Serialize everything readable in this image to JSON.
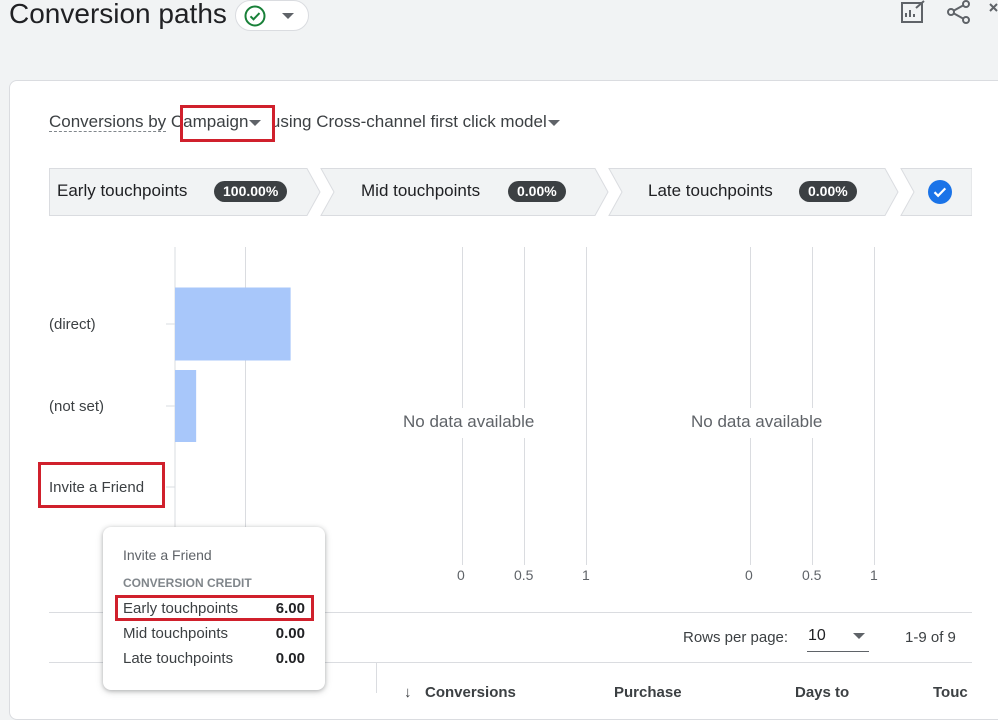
{
  "header": {
    "title": "Conversion paths"
  },
  "selector": {
    "prefix": "Conversions by",
    "dimension": "Campaign",
    "model_text": "using Cross-channel first click model"
  },
  "stages": [
    {
      "label": "Early touchpoints",
      "badge": "100.00%"
    },
    {
      "label": "Mid touchpoints",
      "badge": "0.00%"
    },
    {
      "label": "Late touchpoints",
      "badge": "0.00%"
    }
  ],
  "chart_data": [
    {
      "type": "bar",
      "orientation": "horizontal",
      "categories": [
        "(direct)",
        "(not set)",
        "Invite a Friend"
      ],
      "series": [
        {
          "name": "Early touchpoints",
          "values": [
            0.82,
            0.15,
            0
          ]
        }
      ]
    },
    {
      "type": "bar",
      "orientation": "horizontal",
      "message": "No data available",
      "xticks": [
        "0",
        "0.5",
        "1"
      ]
    },
    {
      "type": "bar",
      "orientation": "horizontal",
      "message": "No data available",
      "xticks": [
        "0",
        "0.5",
        "1"
      ]
    }
  ],
  "tooltip": {
    "title": "Invite a Friend",
    "heading": "CONVERSION CREDIT",
    "rows": [
      {
        "label": "Early touchpoints",
        "value": "6.00"
      },
      {
        "label": "Mid touchpoints",
        "value": "0.00"
      },
      {
        "label": "Late touchpoints",
        "value": "0.00"
      }
    ]
  },
  "pagination": {
    "rows_label": "Rows per page:",
    "rows_value": "10",
    "range": "1-9 of 9"
  },
  "table": {
    "columns": [
      "Conversions",
      "Purchase",
      "Days to",
      "Touc"
    ]
  },
  "colors": {
    "bar": "#a8c7fa",
    "highlight": "#d0202c",
    "check_blue": "#1a73e8",
    "check_green": "#188038"
  }
}
